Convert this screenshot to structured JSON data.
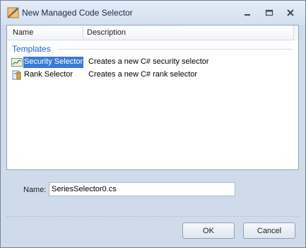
{
  "window": {
    "title": "New Managed Code Selector"
  },
  "list": {
    "columns": [
      "Name",
      "Description"
    ],
    "group": "Templates",
    "items": [
      {
        "name": "Security Selector",
        "description": "Creates a new C# security selector",
        "icon": "security-selector-icon",
        "selected": true
      },
      {
        "name": "Rank Selector",
        "description": "Creates a new C# rank selector",
        "icon": "rank-selector-icon",
        "selected": false
      }
    ]
  },
  "form": {
    "name_label": "Name:",
    "name_value": "SeriesSelector0.cs"
  },
  "buttons": {
    "ok": "OK",
    "cancel": "Cancel"
  },
  "colors": {
    "accent": "#3a7bd5",
    "group_title": "#1d5fbd",
    "window_bg": "#cfdbea"
  }
}
